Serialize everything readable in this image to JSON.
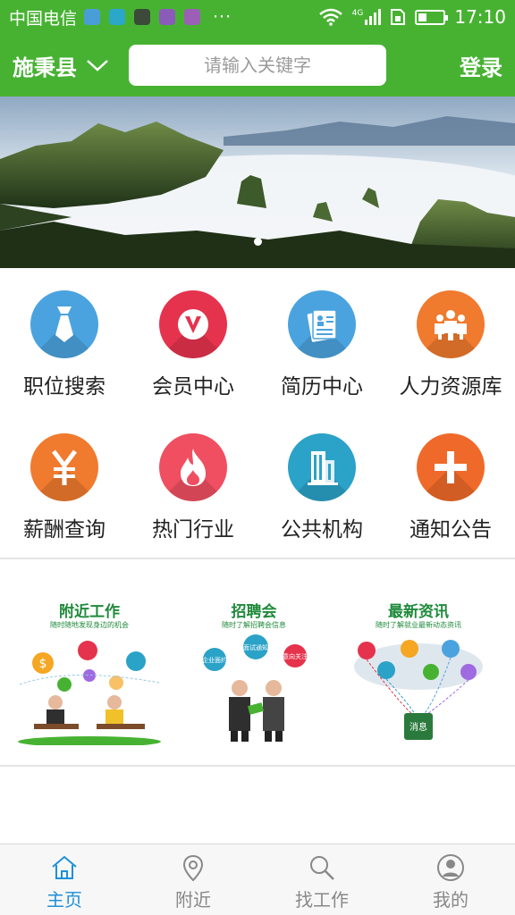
{
  "status_bar": {
    "carrier": "中国电信",
    "more": "···",
    "network": "4G",
    "time": "17:10",
    "battery_level": 0.3
  },
  "header": {
    "city": "施秉县",
    "search_placeholder": "请输入关键字",
    "login": "登录"
  },
  "banner": {
    "slides": 1,
    "active_slide": 1
  },
  "grid": [
    {
      "label": "职位搜索",
      "icon": "tie-icon",
      "color": "#4aa3df"
    },
    {
      "label": "会员中心",
      "icon": "vip-icon",
      "color": "#e5334d"
    },
    {
      "label": "简历中心",
      "icon": "resume-icon",
      "color": "#4aa3df"
    },
    {
      "label": "人力资源库",
      "icon": "people-icon",
      "color": "#f07a2e"
    },
    {
      "label": "薪酬查询",
      "icon": "yen-icon",
      "color": "#f07a2e"
    },
    {
      "label": "热门行业",
      "icon": "flame-icon",
      "color": "#ef4f61"
    },
    {
      "label": "公共机构",
      "icon": "building-icon",
      "color": "#2ba2c7"
    },
    {
      "label": "通知公告",
      "icon": "plus-icon",
      "color": "#ef6a2a"
    }
  ],
  "promos": [
    {
      "title": "附近工作",
      "subtitle": "随时随地发现身边的机会"
    },
    {
      "title": "招聘会",
      "subtitle": "随时了解招聘会信息",
      "bubbles": [
        "面试通知",
        "企业面约",
        "意向关注"
      ]
    },
    {
      "title": "最新资讯",
      "subtitle": "随时了解就业最新动态资讯",
      "badge": "消息"
    }
  ],
  "tabs": [
    {
      "label": "主页",
      "icon": "home-icon",
      "active": true
    },
    {
      "label": "附近",
      "icon": "location-pin-icon",
      "active": false
    },
    {
      "label": "找工作",
      "icon": "search-icon",
      "active": false
    },
    {
      "label": "我的",
      "icon": "user-icon",
      "active": false
    }
  ],
  "colors": {
    "brand_green": "#47b232",
    "tab_active": "#1e90d6",
    "promo_green": "#1f8a3b"
  }
}
